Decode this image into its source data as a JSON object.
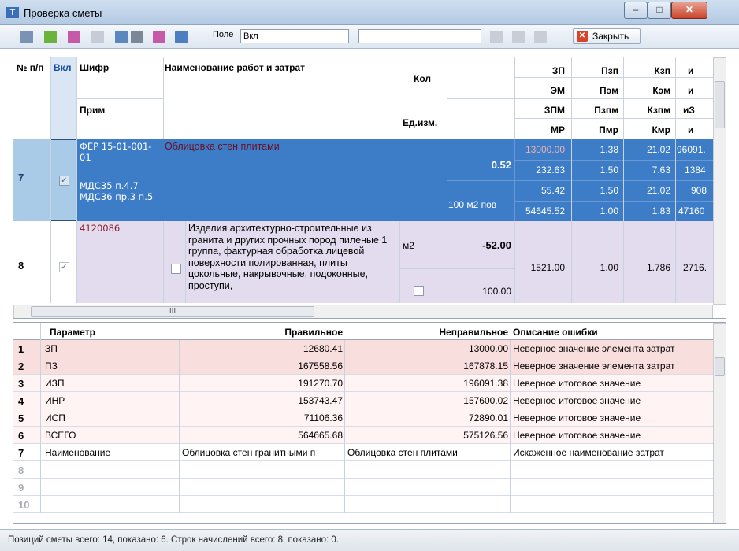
{
  "window": {
    "title": "Проверка сметы",
    "minimize": "–",
    "maximize": "□",
    "close": "✕"
  },
  "toolbar": {
    "field_label": "Поле",
    "field_value": "Вкл",
    "close_label": "Закрыть",
    "close_glyph": "✕"
  },
  "grid": {
    "headers": {
      "num": "№ п/п",
      "on": "Вкл",
      "code": "Шифр",
      "name": "Наименование работ и затрат",
      "note": "Прим",
      "qty": "Кол",
      "unit": "Ед.изм.",
      "r1": [
        "ЗП",
        "Пзп",
        "Кзп",
        "и"
      ],
      "r2": [
        "ЭМ",
        "Пэм",
        "Кэм",
        "и"
      ],
      "r3": [
        "ЗПМ",
        "Пзпм",
        "Кзпм",
        "иЗ"
      ],
      "r4": [
        "МР",
        "Пмр",
        "Кмр",
        "и"
      ]
    },
    "row7": {
      "num": "7",
      "code": "ФЕР 15-01-001-01",
      "name": "Облицовка стен плитами",
      "note": "МДС35 п.4.7 МДС36 пр.3 п.5",
      "qty": "0.52",
      "unit": "100 м2 пов",
      "v1": [
        "13000.00",
        "1.38",
        "21.02",
        "96091."
      ],
      "v2": [
        "232.63",
        "1.50",
        "7.63",
        "1384"
      ],
      "v3": [
        "55.42",
        "1.50",
        "21.02",
        "908"
      ],
      "v4": [
        "54645.52",
        "1.00",
        "1.83",
        "47160"
      ]
    },
    "row8": {
      "num": "8",
      "code": "4120086",
      "name": "Изделия архитектурно-строительные из гранита и других прочных пород пиленые 1 группа, фактурная обработка лицевой поверхности полированная, плиты цокольные, накрывочные, подоконные, проступи,",
      "unit": "м2",
      "qty": "-52.00",
      "qty2": "100.00",
      "v": [
        "1521.00",
        "1.00",
        "1.786",
        "2716."
      ]
    },
    "hscroll_thumb": "III"
  },
  "errors": {
    "headers": {
      "param": "Параметр",
      "correct": "Правильное",
      "wrong": "Неправильное",
      "desc": "Описание ошибки"
    },
    "rows": [
      {
        "n": "1",
        "param": "ЗП",
        "correct": "12680.41",
        "wrong": "13000.00",
        "desc": "Неверное значение элемента затрат"
      },
      {
        "n": "2",
        "param": "ПЗ",
        "correct": "167558.56",
        "wrong": "167878.15",
        "desc": "Неверное значение элемента затрат"
      },
      {
        "n": "3",
        "param": "ИЗП",
        "correct": "191270.70",
        "wrong": "196091.38",
        "desc": "Неверное итоговое значение"
      },
      {
        "n": "4",
        "param": "ИНР",
        "correct": "153743.47",
        "wrong": "157600.02",
        "desc": "Неверное итоговое значение"
      },
      {
        "n": "5",
        "param": "ИСП",
        "correct": "71106.36",
        "wrong": "72890.01",
        "desc": "Неверное итоговое значение"
      },
      {
        "n": "6",
        "param": "ВСЕГО",
        "correct": "564665.68",
        "wrong": "575126.56",
        "desc": "Неверное итоговое значение"
      },
      {
        "n": "7",
        "param": "Наименование",
        "correct": "Облицовка стен гранитными п",
        "wrong": "Облицовка стен плитами",
        "desc": "Искаженное наименование затрат"
      },
      {
        "n": "8",
        "param": "",
        "correct": "",
        "wrong": "",
        "desc": ""
      },
      {
        "n": "9",
        "param": "",
        "correct": "",
        "wrong": "",
        "desc": ""
      },
      {
        "n": "10",
        "param": "",
        "correct": "",
        "wrong": "",
        "desc": ""
      }
    ]
  },
  "status": {
    "text": "Позиций сметы всего: 14, показано: 6.  Строк начислений всего: 8, показано: 0."
  },
  "colors": {
    "selected": "#3d7cc7",
    "error_row": "#f9dede",
    "row8": "#e2dcee"
  }
}
